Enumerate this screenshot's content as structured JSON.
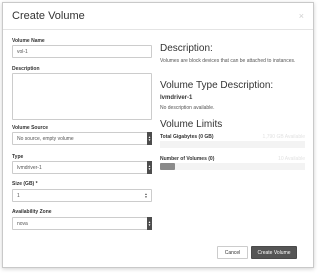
{
  "dialog": {
    "title": "Create Volume",
    "close_glyph": "×"
  },
  "form": {
    "volume_name": {
      "label": "Volume Name",
      "value": "vol-1"
    },
    "description": {
      "label": "Description",
      "value": ""
    },
    "volume_source": {
      "label": "Volume Source",
      "value": "No source, empty volume"
    },
    "type": {
      "label": "Type",
      "value": "lvmdriver-1"
    },
    "size": {
      "label": "Size (GB) *",
      "value": "1"
    },
    "availability_zone": {
      "label": "Availability Zone",
      "value": "nova"
    }
  },
  "info": {
    "description_heading": "Description:",
    "description_text": "Volumes are block devices that can be attached to instances.",
    "type_heading": "Volume Type Description:",
    "type_name": "lvmdriver-1",
    "type_desc": "No description available.",
    "limits_heading": "Volume Limits",
    "total_gb_label": "Total Gigabytes (0 GB)",
    "total_gb_value": "1,790 GB Available",
    "total_gb_fraction": 0.0,
    "num_volumes_label": "Number of Volumes (0)",
    "num_volumes_value": "10 Available",
    "num_volumes_fraction": 0.1
  },
  "footer": {
    "cancel_label": "Cancel",
    "submit_label": "Create Volume"
  },
  "icons": {
    "dropdown": "caret-up-down-icon",
    "stepper": "stepper-icon",
    "close": "close-icon"
  }
}
